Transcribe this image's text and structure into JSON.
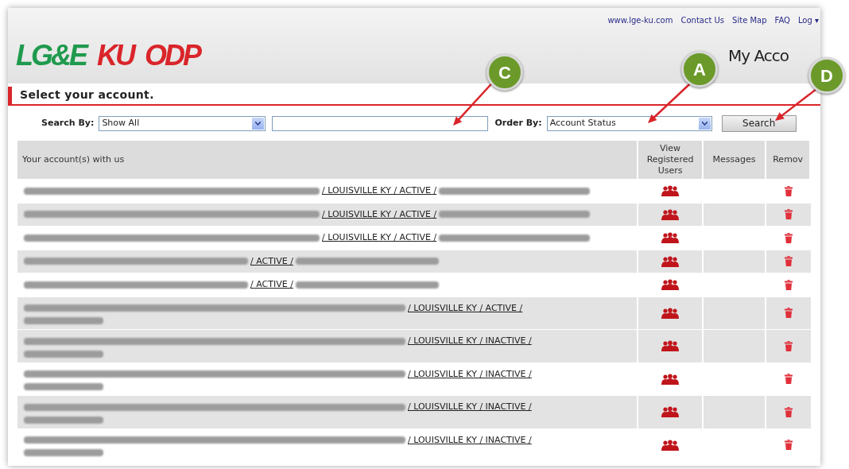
{
  "logos": [
    {
      "text": "LG&E",
      "color": "#1f9a4e"
    },
    {
      "text": "KU",
      "color": "#d9252a"
    },
    {
      "text": "ODP",
      "color": "#d9252a"
    }
  ],
  "top_links": [
    "www.lge-ku.com",
    "Contact Us",
    "Site Map",
    "FAQ",
    "Log ▾"
  ],
  "page_title": "My Acco",
  "section_title": "Select your account.",
  "search": {
    "label": "Search By:",
    "select_value": "Show All",
    "order_label": "Order By:",
    "order_value": "Account Status",
    "button": "Search"
  },
  "table": {
    "columns": [
      "Your account(s) with us",
      "View Registered Users",
      "Messages",
      "Remov"
    ],
    "rows": [
      {
        "text": "/ LOUISVILLE KY / ACTIVE /",
        "kind": "single",
        "shaded": false
      },
      {
        "text": "/ LOUISVILLE KY / ACTIVE /",
        "kind": "single",
        "shaded": true
      },
      {
        "text": "/ LOUISVILLE KY / ACTIVE /",
        "kind": "single",
        "shaded": false
      },
      {
        "text": "/ ACTIVE /",
        "kind": "short",
        "shaded": true
      },
      {
        "text": "/ ACTIVE /",
        "kind": "short",
        "shaded": false
      },
      {
        "text": "/ LOUISVILLE KY / ACTIVE /",
        "kind": "wrapped",
        "shaded": true
      },
      {
        "text": "/ LOUISVILLE KY / INACTIVE /",
        "kind": "wrapped",
        "shaded": true
      },
      {
        "text": "/ LOUISVILLE KY / INACTIVE /",
        "kind": "wrapped",
        "shaded": false
      },
      {
        "text": "/ LOUISVILLE KY / INACTIVE /",
        "kind": "wrapped",
        "shaded": true
      },
      {
        "text": "/ LOUISVILLE KY / INACTIVE /",
        "kind": "wrapped",
        "shaded": false
      }
    ]
  },
  "callouts": [
    {
      "label": "C"
    },
    {
      "label": "A"
    },
    {
      "label": "D"
    }
  ]
}
